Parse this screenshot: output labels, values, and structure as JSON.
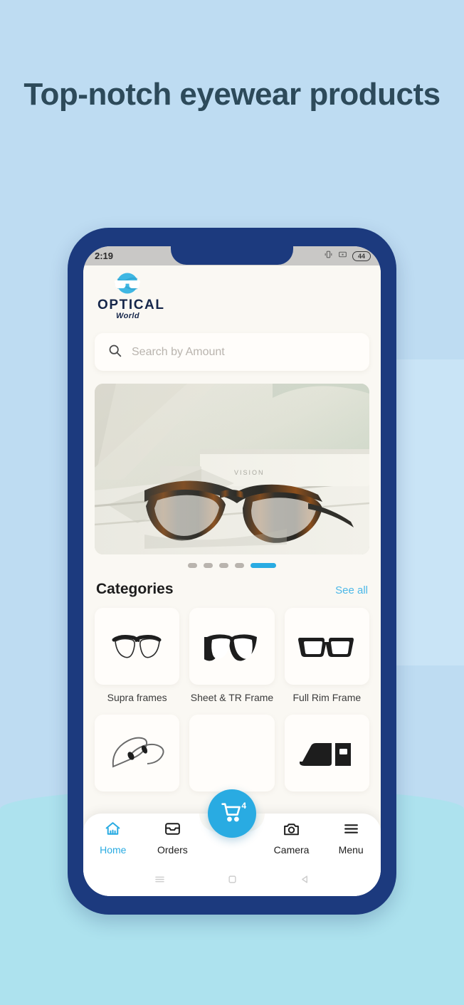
{
  "page": {
    "headline": "Top-notch eyewear products",
    "background_color": "#bedcf2",
    "headline_color": "#2d4a5a",
    "accent_color": "#29abe2",
    "phone_bezel_color": "#1c3a7e",
    "app_background_color": "#faf8f3"
  },
  "status_bar": {
    "time": "2:19",
    "battery_level": "44",
    "icons": [
      "vibrate-icon",
      "sd-card-icon",
      "battery-icon"
    ]
  },
  "brand": {
    "name": "OPTICAL",
    "tagline": "World",
    "logo_icon": "globe-glasses-icon"
  },
  "search": {
    "placeholder": "Search by Amount",
    "value": "",
    "icon": "search-icon"
  },
  "hero": {
    "alt": "eyeglasses-banner",
    "dots_total": 5,
    "active_dot_index": 4
  },
  "categories": {
    "title": "Categories",
    "see_all_label": "See all",
    "items": [
      {
        "label": "Supra frames",
        "icon": "supra-frames-icon"
      },
      {
        "label": "Sheet & TR Frame",
        "icon": "sheet-tr-frame-icon"
      },
      {
        "label": "Full Rim Frame",
        "icon": "full-rim-frame-icon"
      },
      {
        "label": "",
        "icon": "rimless-frame-icon"
      },
      {
        "label": "",
        "icon": "cart-placeholder-icon"
      },
      {
        "label": "",
        "icon": "case-frame-icon"
      }
    ]
  },
  "bottom_nav": {
    "items": [
      {
        "label": "Home",
        "icon": "home-icon",
        "active": true
      },
      {
        "label": "Orders",
        "icon": "inbox-icon",
        "active": false
      },
      {
        "label": "Camera",
        "icon": "camera-icon",
        "active": false
      },
      {
        "label": "Menu",
        "icon": "hamburger-icon",
        "active": false
      }
    ],
    "cart": {
      "icon": "shopping-cart-icon",
      "badge": "4"
    }
  },
  "system_bar": {
    "recents": "recents-icon",
    "home": "home-square-icon",
    "back": "back-triangle-icon"
  }
}
